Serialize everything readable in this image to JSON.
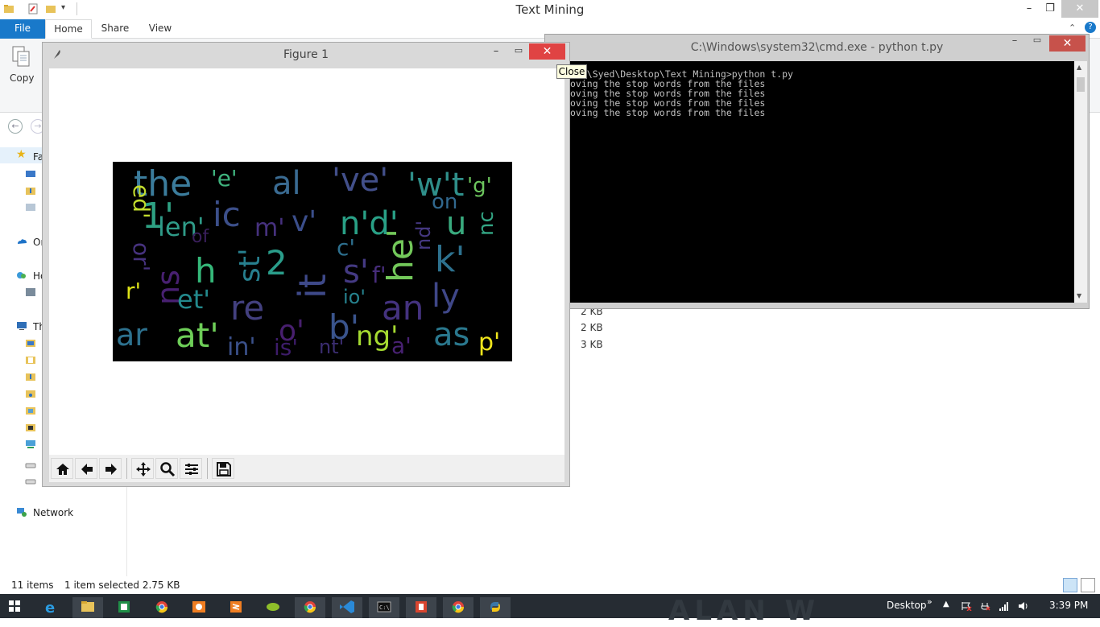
{
  "explorer": {
    "title": "Text Mining",
    "tabs": {
      "file": "File",
      "home": "Home",
      "share": "Share",
      "view": "View"
    },
    "copy_label": "Copy",
    "nav": {
      "favorites": "Fa",
      "onedrive": "Or",
      "homegroup": "Ho",
      "this_pc": "Th",
      "network": "Network"
    },
    "sizes": [
      "2 KB",
      "2 KB",
      "3 KB"
    ],
    "status": {
      "items": "11 items",
      "selected": "1 item selected  2.75 KB"
    },
    "help_glyph": "?"
  },
  "cmd": {
    "title": "C:\\Windows\\system32\\cmd.exe - python  t.py",
    "lines": [
      "ers\\Syed\\Desktop\\Text Mining>python t.py",
      "oving the stop words from the files",
      "oving the stop words from the files",
      "oving the stop words from the files",
      "oving the stop words from the files"
    ]
  },
  "figure": {
    "title": "Figure 1",
    "close_tooltip": "Close",
    "wordcloud": {
      "background": "#000000",
      "words": [
        {
          "text": "the",
          "color": "#3b7c9c"
        },
        {
          "text": "'e'",
          "color": "#3fb37e"
        },
        {
          "text": "al",
          "color": "#3a6b92"
        },
        {
          "text": "'ve'",
          "color": "#424f8a"
        },
        {
          "text": "'w't",
          "color": "#2f8f8a"
        },
        {
          "text": "'g'",
          "color": "#6cc55d"
        },
        {
          "text": "1'",
          "color": "#2ea183"
        },
        {
          "text": "len'",
          "color": "#2f9b88"
        },
        {
          "text": "ic",
          "color": "#3c4f8a"
        },
        {
          "text": "m'",
          "color": "#46317e"
        },
        {
          "text": "v'",
          "color": "#3b4e8b"
        },
        {
          "text": "n'd'",
          "color": "#29a086"
        },
        {
          "text": "on",
          "color": "#31688e"
        },
        {
          "text": "u",
          "color": "#39aa7e"
        },
        {
          "text": "ed'",
          "color": "#c2dc2e"
        },
        {
          "text": "of",
          "color": "#3a1f5c"
        },
        {
          "text": "h",
          "color": "#35b779"
        },
        {
          "text": "st'",
          "color": "#277f8e"
        },
        {
          "text": "2",
          "color": "#2a9d8a"
        },
        {
          "text": "c'",
          "color": "#2d6f8e"
        },
        {
          "text": "nd'",
          "color": "#453882"
        },
        {
          "text": "he'",
          "color": "#73c85a"
        },
        {
          "text": "k'",
          "color": "#2d718e"
        },
        {
          "text": "nc",
          "color": "#33a584"
        },
        {
          "text": "or'",
          "color": "#46327e"
        },
        {
          "text": "ns",
          "color": "#482071"
        },
        {
          "text": "it",
          "color": "#3e4989"
        },
        {
          "text": "s'",
          "color": "#443a83"
        },
        {
          "text": "f'",
          "color": "#472d7b"
        },
        {
          "text": "r'",
          "color": "#dde318"
        },
        {
          "text": "et'",
          "color": "#238a8d"
        },
        {
          "text": "re",
          "color": "#43407f"
        },
        {
          "text": "io'",
          "color": "#26828e"
        },
        {
          "text": "an",
          "color": "#44327f"
        },
        {
          "text": "ly",
          "color": "#3f4788"
        },
        {
          "text": "ar",
          "color": "#2d718e"
        },
        {
          "text": "at'",
          "color": "#6ece58"
        },
        {
          "text": "in'",
          "color": "#3b518b"
        },
        {
          "text": "is'",
          "color": "#3d1c6a"
        },
        {
          "text": "o'",
          "color": "#481f6f"
        },
        {
          "text": "nt'",
          "color": "#3b2d70"
        },
        {
          "text": "b'",
          "color": "#3a548c"
        },
        {
          "text": "ng'",
          "color": "#a5da31"
        },
        {
          "text": "a'",
          "color": "#482173"
        },
        {
          "text": "as",
          "color": "#2a788e"
        },
        {
          "text": "p'",
          "color": "#f0e51c"
        }
      ]
    }
  },
  "taskbar": {
    "watermark": "ALAN W",
    "desktop_label": "Desktop",
    "chevron": "»",
    "clock": "3:39 PM"
  }
}
